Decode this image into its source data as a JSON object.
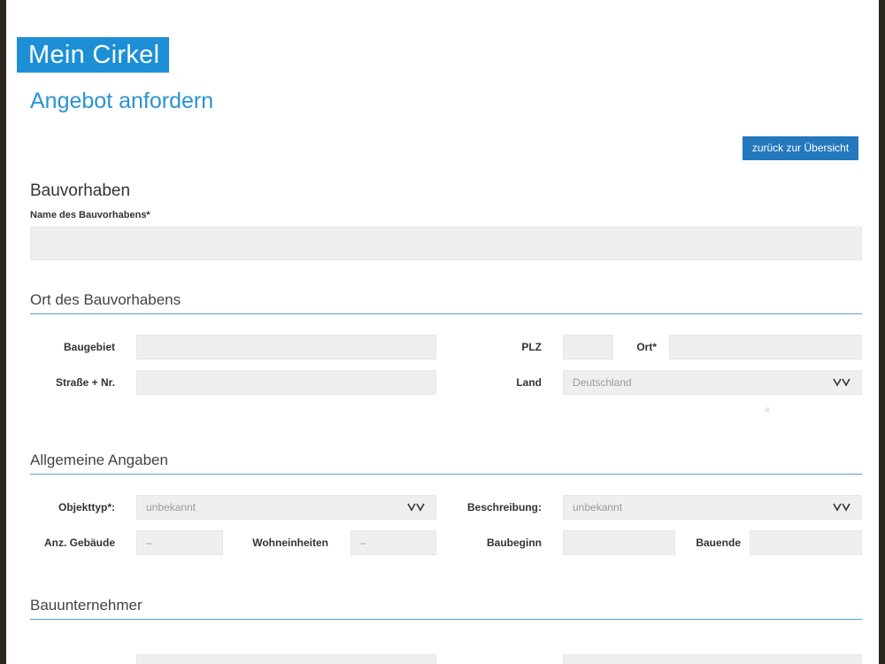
{
  "brand": "Mein Cirkel",
  "page_title": "Angebot anfordern",
  "back_button": "zurück zur Übersicht",
  "bauvorhaben": {
    "heading": "Bauvorhaben",
    "name_label": "Name des Bauvorhabens*",
    "name_value": ""
  },
  "ort": {
    "heading": "Ort des Bauvorhabens",
    "baugebiet_label": "Baugebiet",
    "plz_label": "PLZ",
    "ort_label": "Ort*",
    "strasse_label": "Straße + Nr.",
    "land_label": "Land",
    "land_value": "Deutschland"
  },
  "allgemein": {
    "heading": "Allgemeine Angaben",
    "objekttyp_label": "Objekttyp*:",
    "objekttyp_value": "unbekannt",
    "beschreibung_label": "Beschreibung:",
    "beschreibung_value": "unbekannt",
    "gebaeude_label": "Anz. Gebäude",
    "gebaeude_value": "–",
    "wohneinheiten_label": "Wohneinheiten",
    "wohneinheiten_value": "–",
    "baubeginn_label": "Baubeginn",
    "bauende_label": "Bauende"
  },
  "bauunternehmer": {
    "heading": "Bauunternehmer"
  },
  "icons": {
    "dropdown": "chevron-down-icon"
  },
  "colors": {
    "brand": "#1d8fd6",
    "title": "#2a93d2",
    "button": "#2479be",
    "rule": "#5aa0d6",
    "input_bg": "#efefef"
  }
}
